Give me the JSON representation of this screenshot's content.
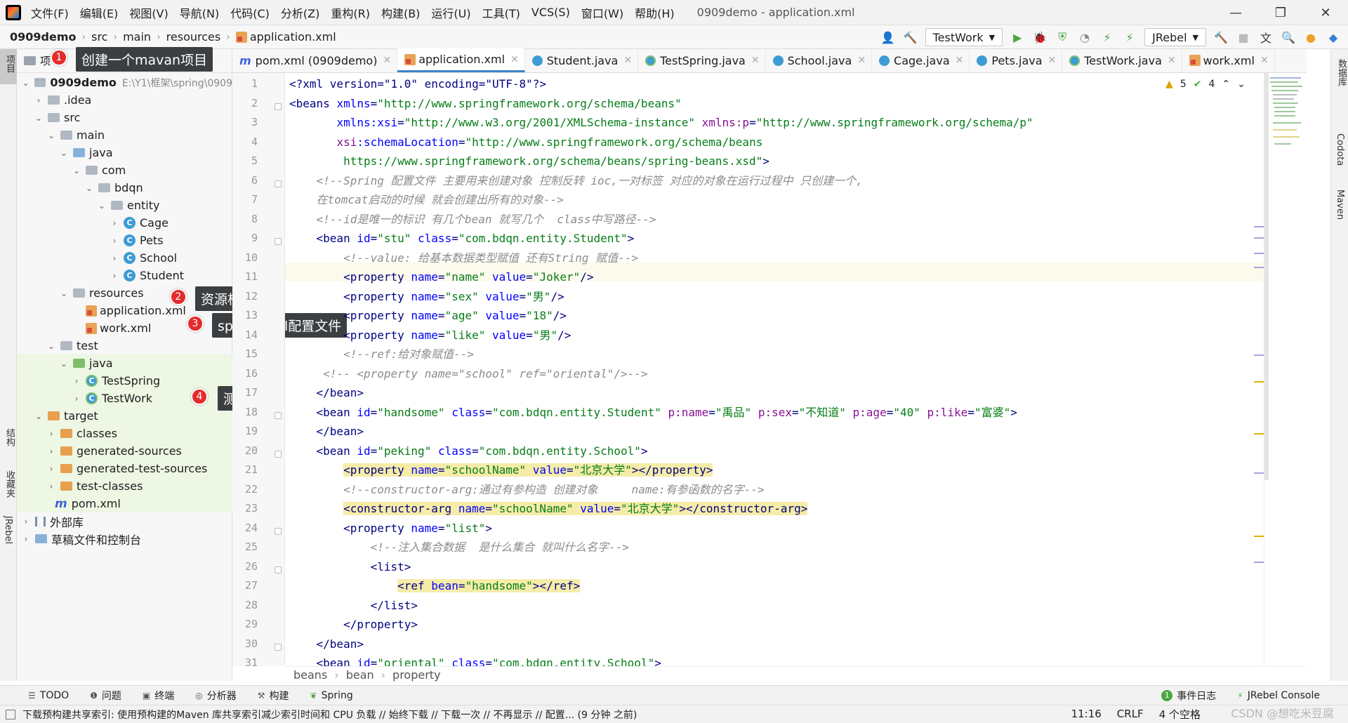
{
  "app": {
    "window_title": "0909demo - application.xml",
    "menu": [
      "文件(F)",
      "编辑(E)",
      "视图(V)",
      "导航(N)",
      "代码(C)",
      "分析(Z)",
      "重构(R)",
      "构建(B)",
      "运行(U)",
      "工具(T)",
      "VCS(S)",
      "窗口(W)",
      "帮助(H)"
    ]
  },
  "navbar": {
    "crumbs": [
      "0909demo",
      "src",
      "main",
      "resources",
      "application.xml"
    ],
    "run_config": "TestWork",
    "jrebel": "JRebel"
  },
  "left_strip": {
    "project": "项目",
    "structure": "结构",
    "favorites": "收藏夹",
    "jrebel": "JRebel"
  },
  "right_strip": {
    "database": "数据库",
    "codota": "Codota",
    "maven": "Maven"
  },
  "project_panel": {
    "header": "项",
    "tree": [
      {
        "label": "0909demo",
        "extra": "E:\\Y1\\框架\\spring\\0909"
      },
      {
        "label": ".idea"
      },
      {
        "label": "src"
      },
      {
        "label": "main"
      },
      {
        "label": "java"
      },
      {
        "label": "com"
      },
      {
        "label": "bdqn"
      },
      {
        "label": "entity"
      },
      {
        "label": "Cage"
      },
      {
        "label": "Pets"
      },
      {
        "label": "School"
      },
      {
        "label": "Student"
      },
      {
        "label": "resources"
      },
      {
        "label": "application.xml"
      },
      {
        "label": "work.xml"
      },
      {
        "label": "test"
      },
      {
        "label": "java"
      },
      {
        "label": "TestSpring"
      },
      {
        "label": "TestWork"
      },
      {
        "label": "target"
      },
      {
        "label": "classes"
      },
      {
        "label": "generated-sources"
      },
      {
        "label": "generated-test-sources"
      },
      {
        "label": "test-classes"
      },
      {
        "label": "pom.xml"
      },
      {
        "label": "外部库"
      },
      {
        "label": "草稿文件和控制台"
      }
    ]
  },
  "annotations": [
    {
      "num": "1",
      "text": "创建一个mavan项目"
    },
    {
      "num": "2",
      "text": "资源根目录"
    },
    {
      "num": "3",
      "text": "spring xml配置文件"
    },
    {
      "num": "4",
      "text": "测试类"
    }
  ],
  "tabs": [
    "pom.xml (0909demo)",
    "application.xml",
    "Student.java",
    "TestSpring.java",
    "School.java",
    "Cage.java",
    "Pets.java",
    "TestWork.java",
    "work.xml"
  ],
  "inspections": {
    "warnings": "5",
    "ok": "4"
  },
  "line_numbers": [
    "1",
    "2",
    "3",
    "4",
    "5",
    "6",
    "7",
    "8",
    "9",
    "10",
    "11",
    "12",
    "13",
    "14",
    "15",
    "16",
    "17",
    "18",
    "19",
    "20",
    "21",
    "22",
    "23",
    "24",
    "25",
    "26",
    "27",
    "28",
    "29",
    "30",
    "31"
  ],
  "code_lines": [
    [
      [
        "pi",
        "<?xml version=\"1.0\" encoding=\"UTF-8\"?>"
      ]
    ],
    [
      [
        "tg",
        "<beans "
      ],
      [
        "an",
        "xmlns"
      ],
      [
        "tg",
        "="
      ],
      [
        "av",
        "\"http://www.springframework.org/schema/beans\""
      ]
    ],
    [
      [
        "tg",
        "       "
      ],
      [
        "an",
        "xmlns:xsi"
      ],
      [
        "tg",
        "="
      ],
      [
        "av",
        "\"http://www.w3.org/2001/XMLSchema-instance\" "
      ],
      [
        "ns",
        "xmlns:p"
      ],
      [
        "tg",
        "="
      ],
      [
        "av",
        "\"http://www.springframework.org/schema/p\""
      ]
    ],
    [
      [
        "tg",
        "       "
      ],
      [
        "ns",
        "xsi"
      ],
      [
        "an",
        ":schemaLocation"
      ],
      [
        "tg",
        "="
      ],
      [
        "av",
        "\"http://www.springframework.org/schema/beans"
      ]
    ],
    [
      [
        "av",
        "        https://www.springframework.org/schema/beans/spring-beans.xsd\""
      ],
      [
        "tg",
        ">"
      ]
    ],
    [
      [
        "cm",
        "    <!--Spring 配置文件 主要用来创建对象 控制反转 ioc,一对标签 对应的对象在运行过程中 只创建一个,"
      ]
    ],
    [
      [
        "cm",
        "    在tomcat启动的时候 就会创建出所有的对象-->"
      ]
    ],
    [
      [
        "cm",
        "    <!--id是唯一的标识 有几个bean 就写几个  class中写路径-->"
      ]
    ],
    [
      [
        "tg",
        "    <bean "
      ],
      [
        "an",
        "id"
      ],
      [
        "tg",
        "="
      ],
      [
        "av",
        "\"stu\" "
      ],
      [
        "an",
        "class"
      ],
      [
        "tg",
        "="
      ],
      [
        "av",
        "\"com.bdqn.entity.Student\""
      ],
      [
        "tg",
        ">"
      ]
    ],
    [
      [
        "cm",
        "        <!--value: 给基本数据类型赋值 还有String 赋值-->"
      ]
    ],
    [
      [
        "tg",
        "        <property "
      ],
      [
        "an",
        "name"
      ],
      [
        "tg",
        "="
      ],
      [
        "av",
        "\"name\" "
      ],
      [
        "an",
        "value"
      ],
      [
        "tg",
        "="
      ],
      [
        "av",
        "\"Joker\""
      ],
      [
        "tg",
        "/>"
      ]
    ],
    [
      [
        "tg",
        "        <property "
      ],
      [
        "an",
        "name"
      ],
      [
        "tg",
        "="
      ],
      [
        "av",
        "\"sex\" "
      ],
      [
        "an",
        "value"
      ],
      [
        "tg",
        "="
      ],
      [
        "av",
        "\"男\""
      ],
      [
        "tg",
        "/>"
      ]
    ],
    [
      [
        "tg",
        "        <property "
      ],
      [
        "an",
        "name"
      ],
      [
        "tg",
        "="
      ],
      [
        "av",
        "\"age\" "
      ],
      [
        "an",
        "value"
      ],
      [
        "tg",
        "="
      ],
      [
        "av",
        "\"18\""
      ],
      [
        "tg",
        "/>"
      ]
    ],
    [
      [
        "tg",
        "        <property "
      ],
      [
        "an",
        "name"
      ],
      [
        "tg",
        "="
      ],
      [
        "av",
        "\"like\" "
      ],
      [
        "an",
        "value"
      ],
      [
        "tg",
        "="
      ],
      [
        "av",
        "\"男\""
      ],
      [
        "tg",
        "/>"
      ]
    ],
    [
      [
        "cm",
        "        <!--ref:给对象赋值-->"
      ]
    ],
    [
      [
        "cm",
        "     <!-- <property name=\"school\" ref=\"oriental\"/>-->"
      ]
    ],
    [
      [
        "tg",
        "    </bean>"
      ]
    ],
    [
      [
        "tg",
        "    <bean "
      ],
      [
        "an",
        "id"
      ],
      [
        "tg",
        "="
      ],
      [
        "av",
        "\"handsome\" "
      ],
      [
        "an",
        "class"
      ],
      [
        "tg",
        "="
      ],
      [
        "av",
        "\"com.bdqn.entity.Student\" "
      ],
      [
        "ns",
        "p:name"
      ],
      [
        "tg",
        "="
      ],
      [
        "av",
        "\"禹品\" "
      ],
      [
        "ns",
        "p:sex"
      ],
      [
        "tg",
        "="
      ],
      [
        "av",
        "\"不知道\" "
      ],
      [
        "ns",
        "p:age"
      ],
      [
        "tg",
        "="
      ],
      [
        "av",
        "\"40\" "
      ],
      [
        "ns",
        "p:like"
      ],
      [
        "tg",
        "="
      ],
      [
        "av",
        "\"富婆\""
      ],
      [
        "tg",
        ">"
      ]
    ],
    [
      [
        "tg",
        "    </bean>"
      ]
    ],
    [
      [
        "tg",
        "    <bean "
      ],
      [
        "an",
        "id"
      ],
      [
        "tg",
        "="
      ],
      [
        "av",
        "\"peking\" "
      ],
      [
        "an",
        "class"
      ],
      [
        "tg",
        "="
      ],
      [
        "av",
        "\"com.bdqn.entity.School\""
      ],
      [
        "tg",
        ">"
      ]
    ],
    [
      [
        "tg",
        "        "
      ],
      [
        "tgh",
        "<property "
      ],
      [
        "anh",
        "name"
      ],
      [
        "tgh",
        "="
      ],
      [
        "avh",
        "\"schoolName\" "
      ],
      [
        "anh",
        "value"
      ],
      [
        "tgh",
        "="
      ],
      [
        "avh",
        "\"北京大学\""
      ],
      [
        "tgh",
        "></property>"
      ]
    ],
    [
      [
        "cm",
        "        <!--constructor-arg:通过有参构造 创建对象     name:有参函数的名字-->"
      ]
    ],
    [
      [
        "tg",
        "        "
      ],
      [
        "tgh",
        "<constructor-arg "
      ],
      [
        "anh",
        "name"
      ],
      [
        "tgh",
        "="
      ],
      [
        "avh",
        "\"schoolName\" "
      ],
      [
        "anh",
        "value"
      ],
      [
        "tgh",
        "="
      ],
      [
        "avh",
        "\"北京大学\""
      ],
      [
        "tgh",
        "></constructor-arg>"
      ]
    ],
    [
      [
        "tg",
        "        <property "
      ],
      [
        "an",
        "name"
      ],
      [
        "tg",
        "="
      ],
      [
        "av",
        "\"list\""
      ],
      [
        "tg",
        ">"
      ]
    ],
    [
      [
        "cm",
        "            <!--注入集合数据  是什么集合 就叫什么名字-->"
      ]
    ],
    [
      [
        "tg",
        "            <list>"
      ]
    ],
    [
      [
        "tg",
        "                "
      ],
      [
        "tgh",
        "<ref "
      ],
      [
        "anh",
        "bean"
      ],
      [
        "tgh",
        "="
      ],
      [
        "avh",
        "\"handsome\""
      ],
      [
        "tgh",
        "></ref>"
      ]
    ],
    [
      [
        "tg",
        "            </list>"
      ]
    ],
    [
      [
        "tg",
        "        </property>"
      ]
    ],
    [
      [
        "tg",
        "    </bean>"
      ]
    ],
    [
      [
        "tg",
        "    <bean "
      ],
      [
        "an",
        "id"
      ],
      [
        "tg",
        "="
      ],
      [
        "av",
        "\"oriental\" "
      ],
      [
        "an",
        "class"
      ],
      [
        "tg",
        "="
      ],
      [
        "av",
        "\"com.bdqn.entity.School\""
      ],
      [
        "tg",
        ">"
      ]
    ]
  ],
  "breadcrumb": [
    "beans",
    "bean",
    "property"
  ],
  "bottom_tools": [
    "TODO",
    "问题",
    "终端",
    "分析器",
    "构建",
    "Spring"
  ],
  "bottom_right_tools": [
    "事件日志",
    "JRebel Console"
  ],
  "event_count": "1",
  "status": {
    "message": "下载预构建共享索引: 使用预构建的Maven 库共享索引减少索引时间和 CPU 负载 // 始终下载 // 下载一次 // 不再显示 // 配置... (9 分钟 之前)",
    "position": "11:16",
    "line_sep": "CRLF",
    "indent": "4 个空格",
    "watermark": "CSDN @想吃米豆腐"
  }
}
